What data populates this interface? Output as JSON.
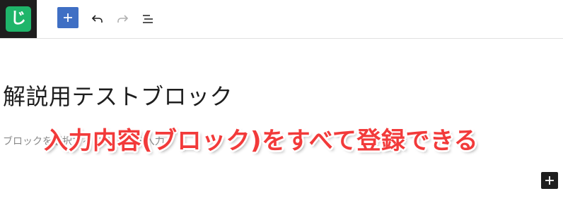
{
  "app": {
    "logo_text": "じ"
  },
  "toolbar": {
    "add_block_icon": "plus-icon",
    "undo_icon": "undo-icon",
    "redo_icon": "redo-icon",
    "outline_icon": "list-view-icon"
  },
  "editor": {
    "title": "解説用テストブロック",
    "placeholder": "ブロックを選択するには「/」を入力"
  },
  "annotation": {
    "text": "入力内容(ブロック)をすべて登録できる"
  },
  "colors": {
    "primary": "#3f6fc4",
    "logo_bg": "#1fb56a",
    "annotation": "#f23a3a",
    "dark": "#1e1e1e"
  }
}
